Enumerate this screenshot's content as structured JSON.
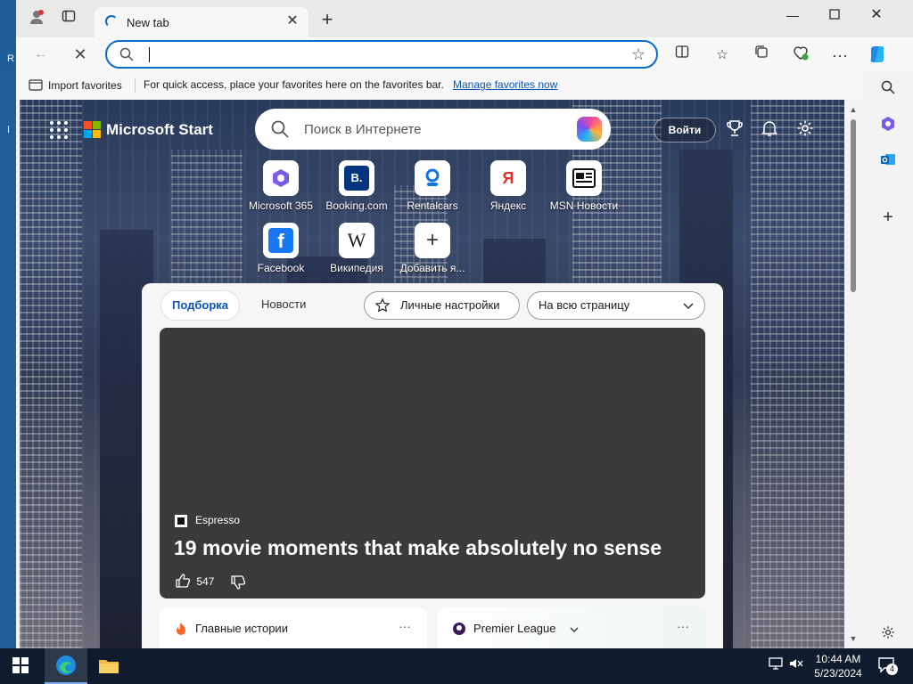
{
  "desktop": {
    "edge_letters": [
      "R",
      "I"
    ]
  },
  "tab": {
    "title": "New tab"
  },
  "address_bar": {
    "value": "",
    "placeholder": ""
  },
  "favorites_bar": {
    "import_label": "Import favorites",
    "hint": "For quick access, place your favorites here on the favorites bar.",
    "manage_link": "Manage favorites now"
  },
  "msn": {
    "brand": "Microsoft Start",
    "search_placeholder": "Поиск в Интернете",
    "login_label": "Войти",
    "quick_links": [
      {
        "label": "Microsoft 365",
        "icon": "microsoft-365-icon"
      },
      {
        "label": "Booking.com",
        "icon": "booking-icon",
        "glyph": "B."
      },
      {
        "label": "Rentalcars",
        "icon": "rentalcars-icon"
      },
      {
        "label": "Яндекс",
        "icon": "yandex-icon",
        "glyph": "Я"
      },
      {
        "label": "MSN Новости",
        "icon": "msn-news-icon"
      },
      {
        "label": "Facebook",
        "icon": "facebook-icon",
        "glyph": "f"
      },
      {
        "label": "Википедия",
        "icon": "wikipedia-icon",
        "glyph": "W"
      },
      {
        "label": "Добавить я...",
        "icon": "add-icon",
        "glyph": "+"
      }
    ],
    "feed": {
      "tabs": [
        "Подборка",
        "Новости"
      ],
      "personalize_label": "Личные настройки",
      "layout_select": "На всю страницу",
      "hero": {
        "source": "Espresso",
        "headline": "19 movie moments that make absolutely no sense",
        "likes": "547"
      },
      "cards": [
        {
          "title": "Главные истории"
        },
        {
          "title": "Premier League"
        }
      ]
    }
  },
  "taskbar": {
    "time": "10:44 AM",
    "date": "5/23/2024",
    "notifications": "4"
  },
  "colors": {
    "accent": "#0b6bcb",
    "link": "#0b55b5",
    "taskbar": "#0f1c2e"
  }
}
